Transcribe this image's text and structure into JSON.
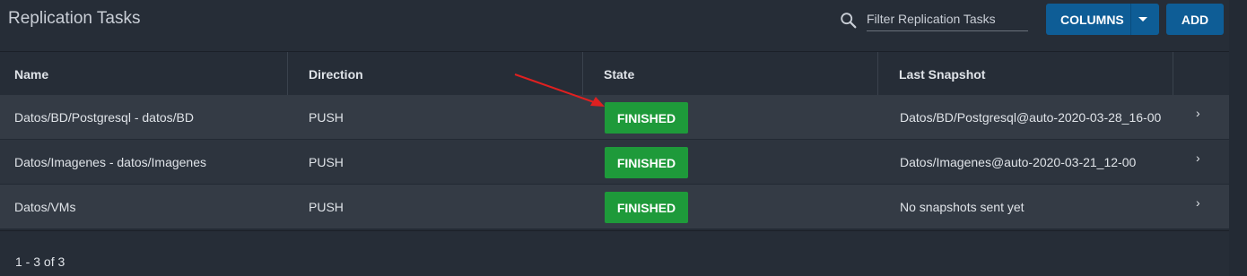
{
  "header": {
    "title": "Replication Tasks",
    "search_placeholder": "Filter Replication Tasks",
    "search_icon": "search-icon",
    "columns_label": "COLUMNS",
    "add_label": "ADD"
  },
  "table": {
    "columns": [
      "Name",
      "Direction",
      "State",
      "Last Snapshot"
    ],
    "rows": [
      {
        "name": "Datos/BD/Postgresql - datos/BD",
        "direction": "PUSH",
        "state": "FINISHED",
        "last_snapshot": "Datos/BD/Postgresql@auto-2020-03-28_16-00"
      },
      {
        "name": "Datos/Imagenes - datos/Imagenes",
        "direction": "PUSH",
        "state": "FINISHED",
        "last_snapshot": "Datos/Imagenes@auto-2020-03-21_12-00"
      },
      {
        "name": "Datos/VMs",
        "direction": "PUSH",
        "state": "FINISHED",
        "last_snapshot": "No snapshots sent yet"
      }
    ]
  },
  "footer": {
    "range": "1 - 3 of 3"
  },
  "colors": {
    "accent": "#0e5d96",
    "success": "#1e9a3a",
    "annotation_arrow": "#e02020"
  }
}
